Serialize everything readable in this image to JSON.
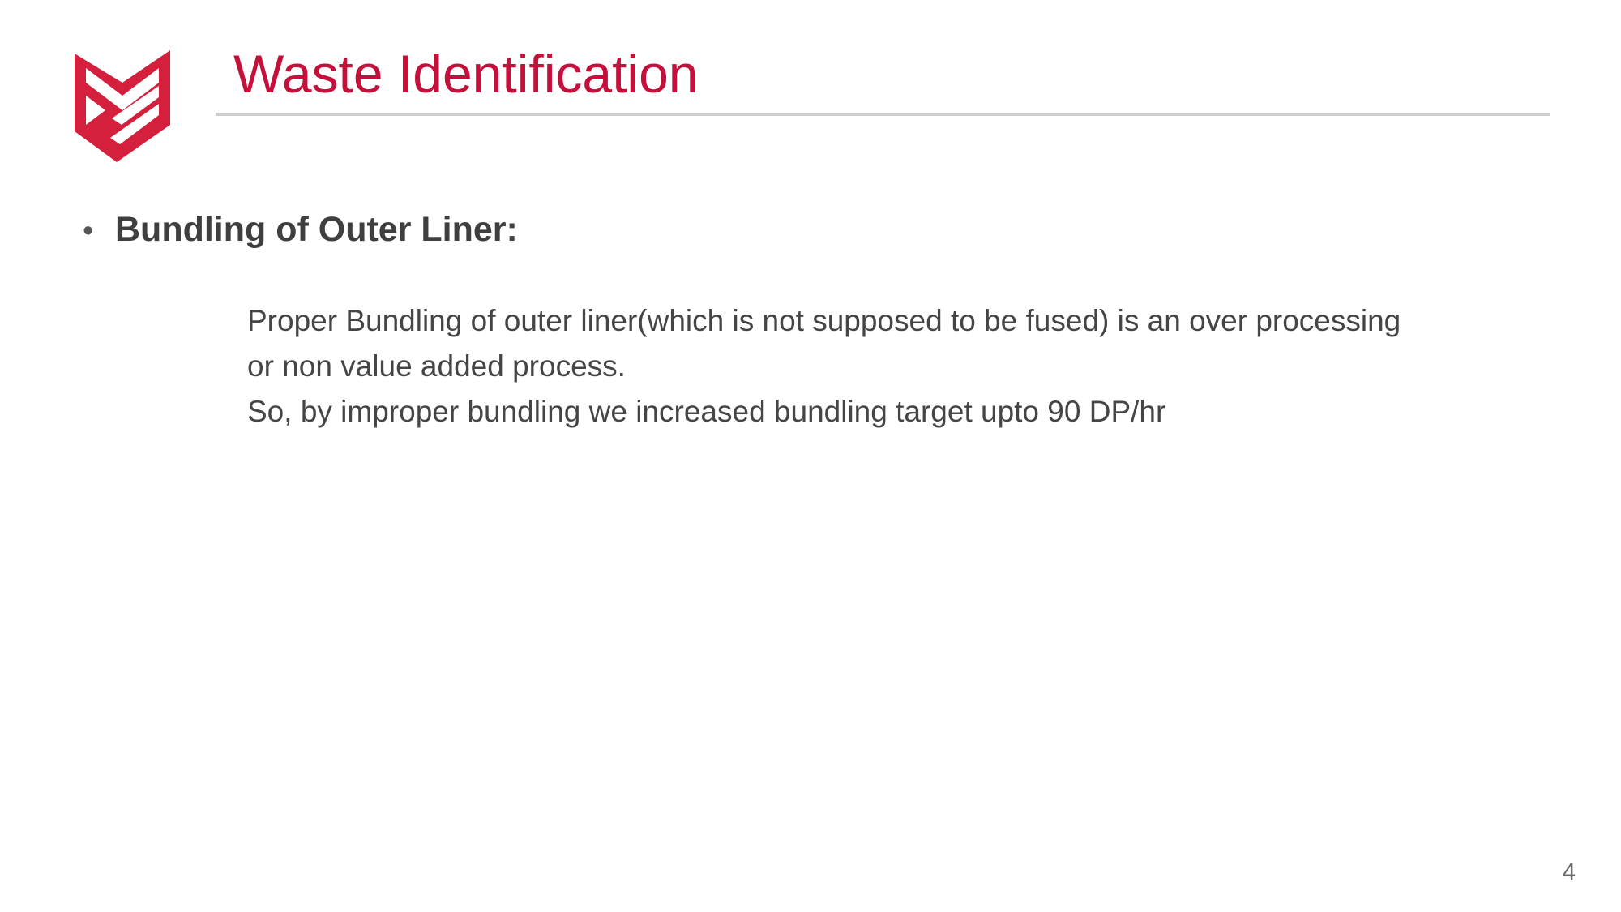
{
  "slide": {
    "title": "Waste Identification",
    "bullet": {
      "marker": "•",
      "heading": "Bundling of Outer Liner:"
    },
    "body_lines": [
      "Proper Bundling of outer liner(which is not supposed to be fused) is an over processing",
      "or non value added process.",
      "So, by improper bundling we increased bundling target upto 90 DP/hr"
    ],
    "page_number": "4"
  },
  "colors": {
    "accent": "#c4103a",
    "text": "#454545",
    "rule": "#cfcfcf"
  },
  "icons": {
    "logo": "brand-logo-icon"
  }
}
